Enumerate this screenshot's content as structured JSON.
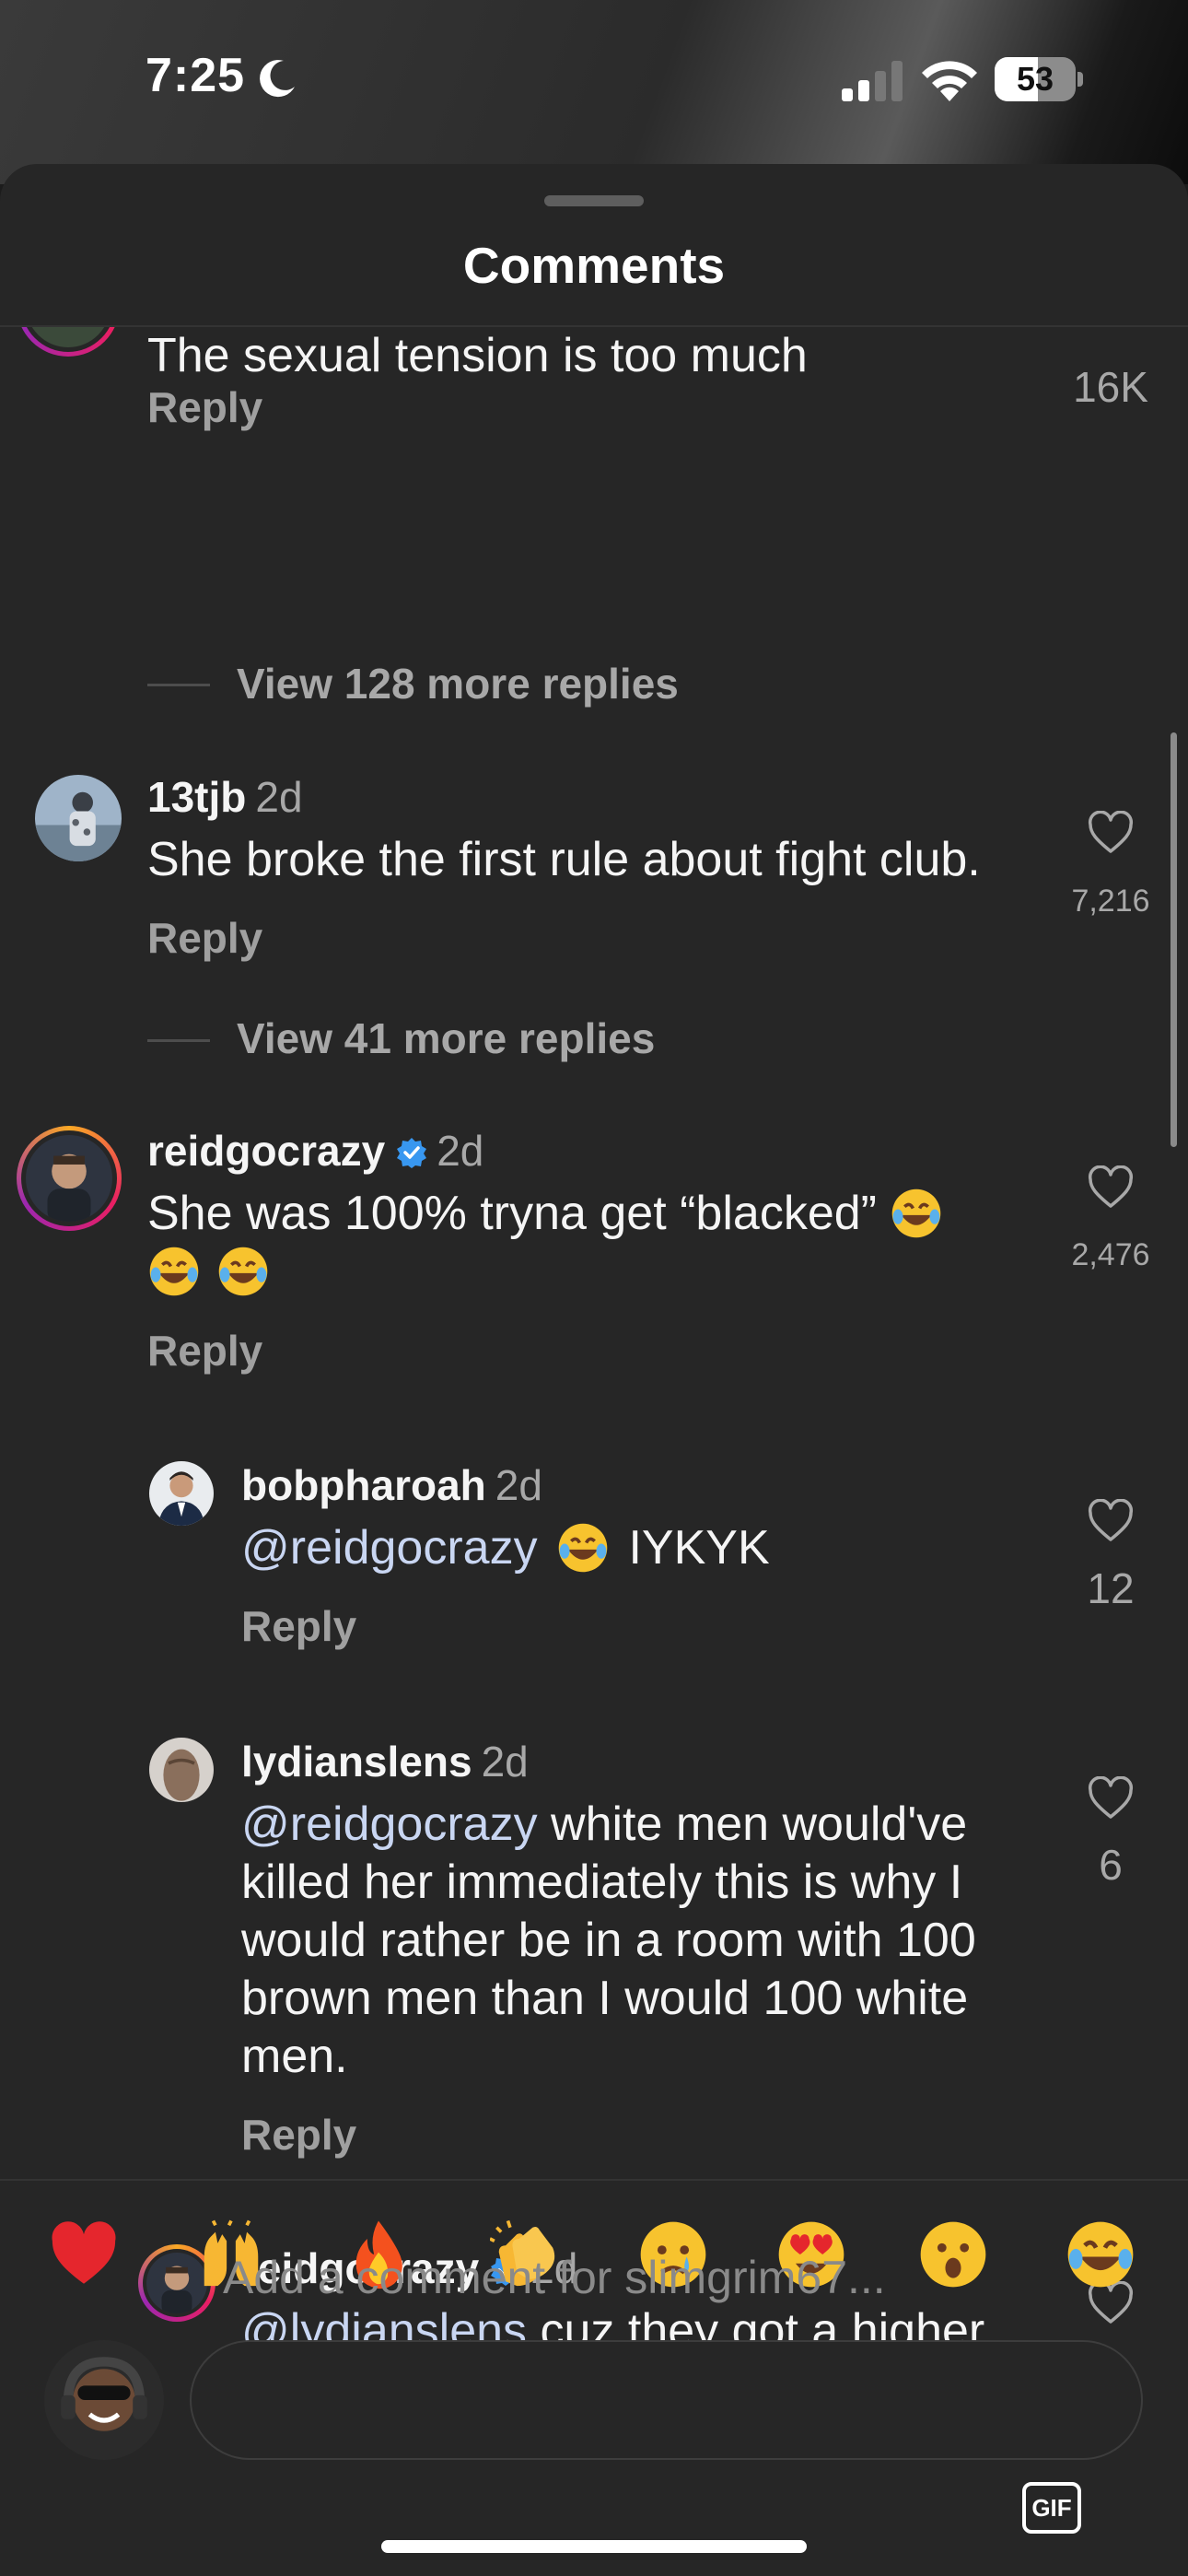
{
  "status_bar": {
    "time": "7:25",
    "battery": "53",
    "battery_level": 0.53,
    "icons": [
      "moon-icon",
      "signal-icon",
      "wifi-icon",
      "battery-icon"
    ]
  },
  "sheet": {
    "title": "Comments"
  },
  "comments": [
    {
      "body": "The sexual tension is too much",
      "reply": "Reply",
      "likes": "16K",
      "more_replies": "View 128 more replies"
    },
    {
      "username": "13tjb",
      "time": "2d",
      "body": "She broke the first rule about fight club.",
      "reply": "Reply",
      "likes": "7,216",
      "more_replies": "View 41 more replies"
    },
    {
      "username": "reidgocrazy",
      "time": "2d",
      "body_line1": "She was 100% tryna get “blacked”",
      "reply": "Reply",
      "likes": "2,476"
    }
  ],
  "replies": [
    {
      "username": "bobpharoah",
      "time": "2d",
      "mention": "@reidgocrazy",
      "text": "IYKYK",
      "reply": "Reply",
      "likes": "12"
    },
    {
      "username": "lydianslens",
      "time": "2d",
      "mention": "@reidgocrazy",
      "text_line1": "white men would've",
      "line2": "killed her immediately this is why I",
      "line3": "would rather be in a room with 100",
      "line4": "brown men than I would 100 white",
      "line5": "men.",
      "reply": "Reply",
      "likes": "6"
    },
    {
      "username": "reidgocrazy",
      "time": "2d",
      "mention": "@lydianslens",
      "text": "cuz they got a higher"
    }
  ],
  "composer": {
    "reactions": [
      "heart-emoji",
      "raising-hands-emoji",
      "fire-emoji",
      "clapping-emoji",
      "crying-emoji",
      "heart-eyes-emoji",
      "surprised-emoji",
      "laughing-emoji"
    ],
    "placeholder": "Add a comment for slimgrim67...",
    "gif_label": "GIF"
  },
  "colors": {
    "sheet": "#262626",
    "text": "#f5f5f5",
    "muted": "#a8a8a8",
    "mention": "#c9d6f2",
    "verified": "#3897f0"
  }
}
